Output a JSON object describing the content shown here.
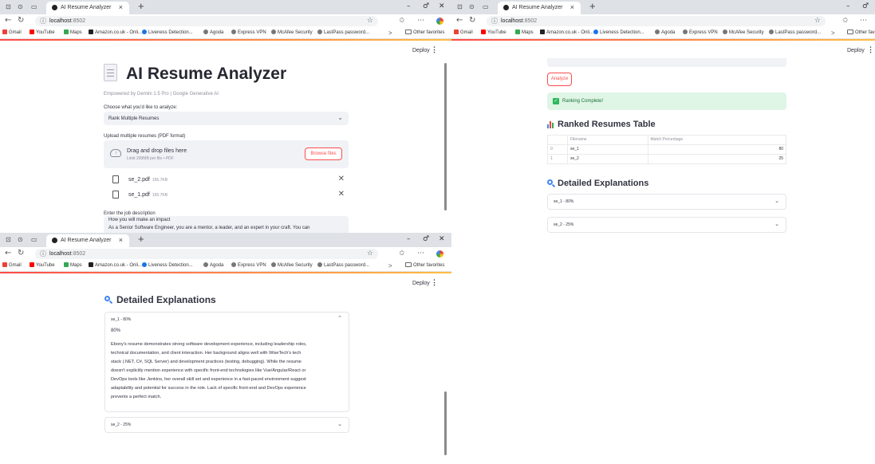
{
  "browser": {
    "tab_title": "AI Resume Analyzer",
    "tab_close": "×",
    "new_tab": "+",
    "url_host": "localhost",
    "url_port": ":8502",
    "window_controls": [
      "–",
      "♂",
      "✕"
    ],
    "bookmarks": [
      {
        "label": "Gmail",
        "color": "#ea4335"
      },
      {
        "label": "YouTube",
        "color": "#ff0000"
      },
      {
        "label": "Maps",
        "color": "#34a853"
      },
      {
        "label": "Amazon.co.uk - Onli...",
        "color": "#222222"
      },
      {
        "label": "Liveness Detection...",
        "color": "#1a73e8"
      },
      {
        "label": "Agoda",
        "color": "#777777"
      },
      {
        "label": "Express VPN",
        "color": "#777777"
      },
      {
        "label": "McAfee Security",
        "color": "#777777"
      },
      {
        "label": "LastPass password...",
        "color": "#777777"
      }
    ],
    "other_favorites": "Other favorites",
    "more": ">"
  },
  "app": {
    "deploy_label": "Deploy",
    "menu_glyph": "⋮",
    "title": "AI Resume Analyzer",
    "caption": "Empowered by Gemini 1.5 Pro | Google Generative AI",
    "choose_label": "Choose what you'd like to analyze:",
    "choose_value": "Rank Multiple Resumes",
    "chevron_down": "⌄",
    "chevron_up": "⌃",
    "upload_label": "Upload multiple resumes (PDF format)",
    "drag_text": "Drag and drop files here",
    "limit_text": "Limit 200MB per file • PDF",
    "browse_label": "Browse files",
    "files": [
      {
        "name": "se_2.pdf",
        "size": "156.7KB"
      },
      {
        "name": "se_1.pdf",
        "size": "155.7KB"
      }
    ],
    "remove_glyph": "✕",
    "jd_label": "Enter the job description",
    "jd_lines": [
      "How you will make an impact",
      "As a Senior Software Engineer, you are a mentor, a leader, and an expert in your craft. You can"
    ],
    "analyze_label": "Analyze",
    "success_text": "Ranking Complete!",
    "success_check": "✓",
    "ranked_heading": "Ranked Resumes Table",
    "table": {
      "columns": [
        "",
        "Filename",
        "Match Percentage"
      ],
      "rows": [
        {
          "idx": "0",
          "filename": "se_1",
          "match": "80"
        },
        {
          "idx": "1",
          "filename": "se_2",
          "match": "25"
        }
      ]
    },
    "explanations_heading": "Detailed Explanations",
    "expanders": [
      {
        "label": "se_1 - 80%"
      },
      {
        "label": "se_2 - 25%"
      }
    ],
    "explanation_pct": "80%",
    "explanation_lines": [
      "Ebony's resume demonstrates strong software development experience, including leadership roles,",
      "technical documentation, and client interaction. Her background aligns well with WiseTech's tech",
      "stack (.NET, C#, SQL Server) and development practices (testing, debugging). While the resume",
      "doesn't explicitly mention experience with specific front-end technologies like Vue/Angular/React or",
      "DevOps tools like Jenkins, her overall skill set and experience in a fast-paced environment suggest",
      "adaptability and potential for success in the role. Lack of specific front-end and DevOps experience",
      "prevents a perfect match."
    ]
  },
  "colors": {
    "accent": "#ff4b4b",
    "success_bg": "#dff5e6",
    "success_text": "#177233",
    "input_bg": "#f0f2f6"
  }
}
